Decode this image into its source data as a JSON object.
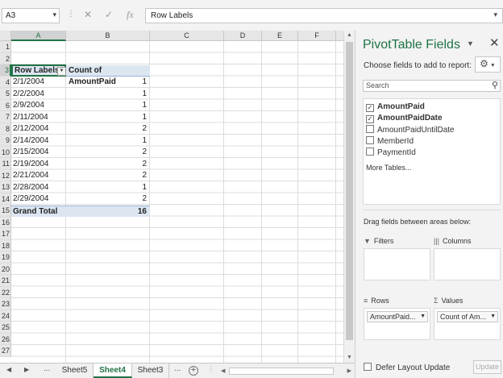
{
  "namebox": {
    "value": "A3"
  },
  "formula": {
    "value": "Row Labels",
    "cancel_icon": "✕",
    "enter_icon": "✓",
    "fx_label": "fx"
  },
  "columns": [
    "A",
    "B",
    "C",
    "D",
    "E",
    "F"
  ],
  "rows": [
    "1",
    "2",
    "3",
    "4",
    "5",
    "6",
    "7",
    "8",
    "9",
    "10",
    "11",
    "12",
    "13",
    "14",
    "15",
    "16",
    "17",
    "18",
    "19",
    "20",
    "21",
    "22",
    "23",
    "24",
    "25",
    "26",
    "27"
  ],
  "pivot": {
    "header": {
      "row_labels": "Row Labels",
      "value_label": "Count of AmountPaid"
    },
    "entries": [
      {
        "date": "2/1/2004",
        "count": "1"
      },
      {
        "date": "2/2/2004",
        "count": "1"
      },
      {
        "date": "2/9/2004",
        "count": "1"
      },
      {
        "date": "2/11/2004",
        "count": "1"
      },
      {
        "date": "2/12/2004",
        "count": "2"
      },
      {
        "date": "2/14/2004",
        "count": "1"
      },
      {
        "date": "2/15/2004",
        "count": "2"
      },
      {
        "date": "2/19/2004",
        "count": "2"
      },
      {
        "date": "2/21/2004",
        "count": "2"
      },
      {
        "date": "2/28/2004",
        "count": "1"
      },
      {
        "date": "2/29/2004",
        "count": "2"
      }
    ],
    "total": {
      "label": "Grand Total",
      "count": "16"
    }
  },
  "tabs": {
    "ellipsis_left": "...",
    "sheets": [
      {
        "name": "Sheet5",
        "active": false
      },
      {
        "name": "Sheet4",
        "active": true
      },
      {
        "name": "Sheet3",
        "active": false
      }
    ],
    "ellipsis_right": "...",
    "add_label": "+"
  },
  "panel": {
    "title": "PivotTable Fields",
    "choose_label": "Choose fields to add to report:",
    "search_placeholder": "Search",
    "fields": [
      {
        "name": "AmountPaid",
        "checked": true
      },
      {
        "name": "AmountPaidDate",
        "checked": true
      },
      {
        "name": "AmountPaidUntilDate",
        "checked": false
      },
      {
        "name": "MemberId",
        "checked": false
      },
      {
        "name": "PaymentId",
        "checked": false
      }
    ],
    "more_tables": "More Tables...",
    "drag_label": "Drag fields between areas below:",
    "areas": {
      "filters": {
        "label": "Filters",
        "icon": "▼"
      },
      "columns": {
        "label": "Columns",
        "icon": "|||"
      },
      "rows": {
        "label": "Rows",
        "icon": "≡",
        "pill": "AmountPaid..."
      },
      "values": {
        "label": "Values",
        "icon": "Σ",
        "pill": "Count of Am..."
      }
    },
    "defer_label": "Defer Layout Update",
    "update_label": "Update"
  },
  "colors": {
    "accent": "#217346",
    "pivot_header": "#dce6f1"
  }
}
